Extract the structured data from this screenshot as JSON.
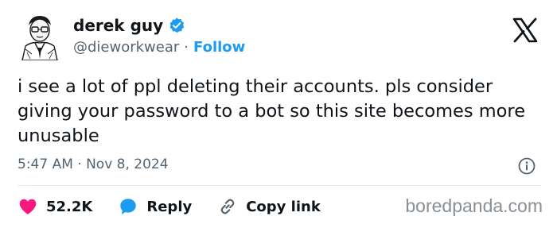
{
  "author": {
    "name": "derek guy",
    "handle": "@dieworkwear",
    "separator": "·",
    "follow_label": "Follow",
    "verified_color": "#1d9bf0"
  },
  "tweet": {
    "text": "i see a lot of ppl deleting their accounts. pls consider giving your password to a bot so this site becomes more unusable",
    "timestamp": "5:47 AM · Nov 8, 2024"
  },
  "actions": {
    "like_count": "52.2K",
    "reply_label": "Reply",
    "copy_label": "Copy link"
  },
  "watermark": "boredpanda.com",
  "colors": {
    "accent": "#1d9bf0",
    "like": "#f91880",
    "text": "#0f1419",
    "muted": "#536471"
  },
  "icons": [
    "avatar-illustration",
    "verified-badge-icon",
    "x-logo-icon",
    "info-icon",
    "heart-icon",
    "reply-bubble-icon",
    "link-icon"
  ]
}
